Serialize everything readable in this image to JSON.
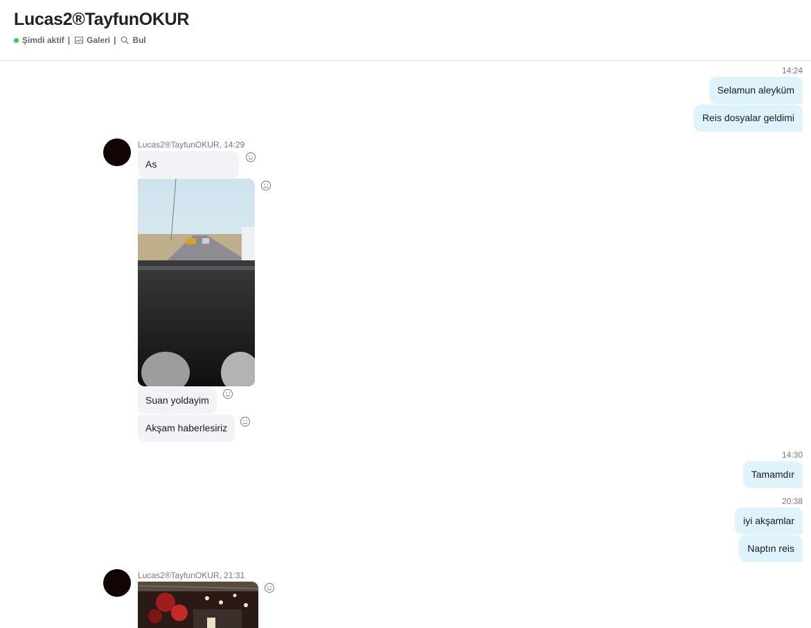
{
  "header": {
    "title": "Lucas2®TayfunOKUR",
    "status_label": "Şimdi aktif",
    "gallery_label": "Galeri",
    "find_label": "Bul",
    "separator": "|",
    "status_color": "#3cc85a"
  },
  "conversation": {
    "groups": [
      {
        "direction": "outgoing",
        "time": "14:24",
        "messages": [
          "Selamun aleyküm",
          "Reis dosyalar geldimi"
        ]
      },
      {
        "direction": "incoming",
        "sender": "Lucas2®TayfunOKUR, 14:29",
        "messages": [
          "As",
          "[photo]",
          "Suan yoldayim",
          "Akşam haberlesiriz"
        ]
      },
      {
        "direction": "outgoing",
        "time": "14:30",
        "messages": [
          "Tamamdır"
        ]
      },
      {
        "direction": "outgoing",
        "time": "20:38",
        "messages": [
          "iyi akşamlar",
          "Naptın reis"
        ]
      },
      {
        "direction": "incoming",
        "sender": "Lucas2®TayfunOKUR, 21:31",
        "messages": [
          "[photo]"
        ]
      }
    ]
  },
  "colors": {
    "outgoing_bubble": "#dff3fd",
    "incoming_bubble": "#f1f3f6",
    "avatar": "#120404"
  },
  "icons": {
    "react": "smiley-icon",
    "gallery": "gallery-icon",
    "find": "search-icon",
    "status": "online-dot-icon"
  }
}
